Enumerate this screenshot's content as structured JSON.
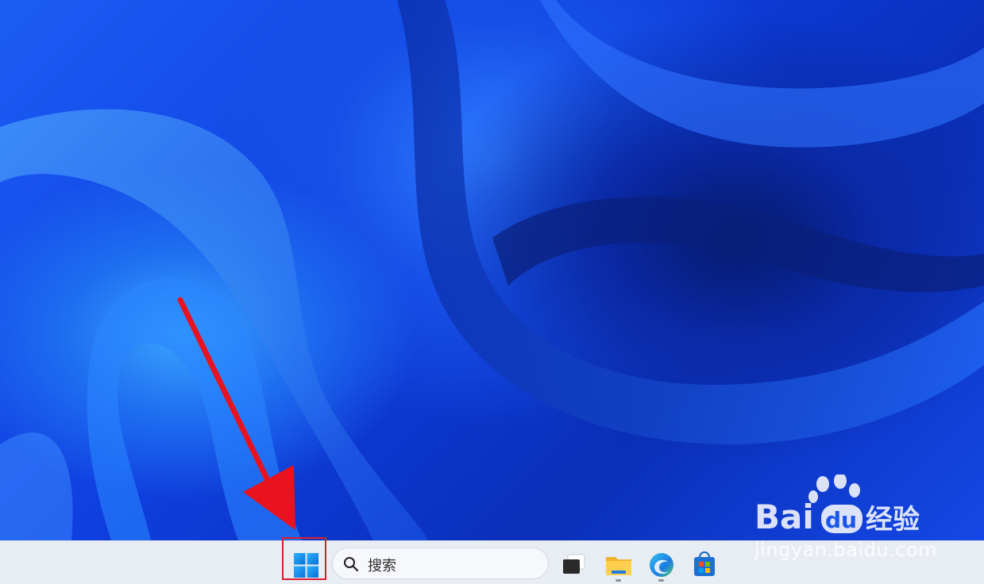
{
  "taskbar": {
    "search_placeholder": "搜索",
    "apps": [
      {
        "name": "Task View",
        "icon": "task-view-icon"
      },
      {
        "name": "File Explorer",
        "icon": "folder-icon"
      },
      {
        "name": "Microsoft Edge",
        "icon": "edge-icon"
      },
      {
        "name": "Microsoft Store",
        "icon": "store-icon"
      }
    ]
  },
  "watermark": {
    "brand": "Bai du 经验",
    "url": "jingyan.baidu.com"
  },
  "colors": {
    "highlight_box": "#e21d2b",
    "arrow": "#e8131f",
    "taskbar_bg": "#e8ecf3",
    "windows_logo": "#1a8fe8"
  }
}
